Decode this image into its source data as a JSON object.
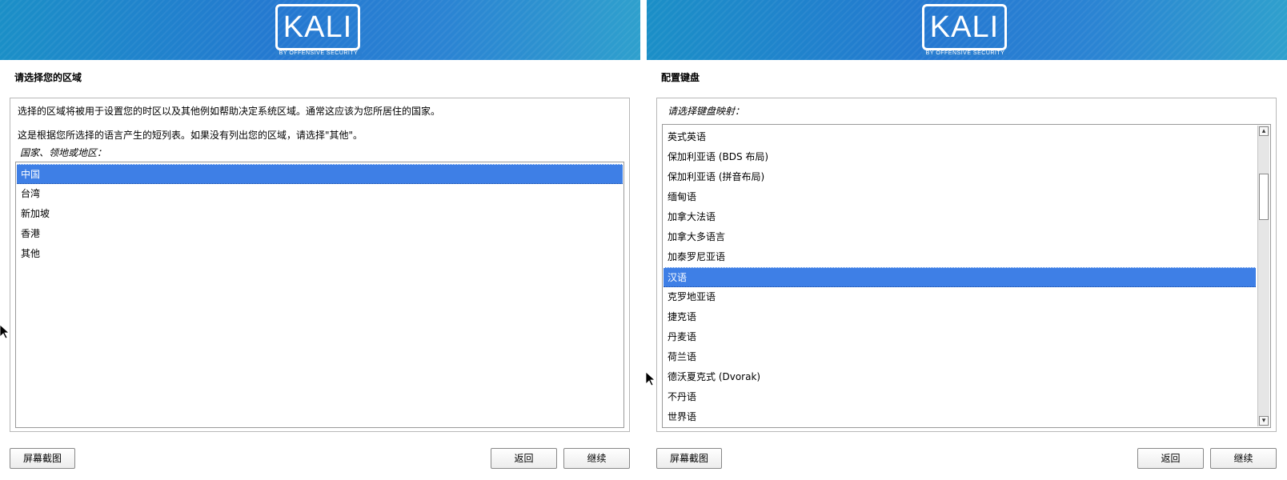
{
  "left": {
    "logo": {
      "text": "KALI",
      "subtitle": "BY OFFENSIVE SECURITY"
    },
    "title": "请选择您的区域",
    "description1": "选择的区域将被用于设置您的时区以及其他例如帮助决定系统区域。通常这应该为您所居住的国家。",
    "description2": "这是根据您所选择的语言产生的短列表。如果没有列出您的区域，请选择\"其他\"。",
    "prompt": "国家、领地或地区：",
    "items": [
      "中国",
      "台湾",
      "新加坡",
      "香港",
      "其他"
    ],
    "selected_index": 0,
    "buttons": {
      "screenshot": "屏幕截图",
      "back": "返回",
      "continue": "继续"
    }
  },
  "right": {
    "logo": {
      "text": "KALI",
      "subtitle": "BY OFFENSIVE SECURITY"
    },
    "title": "配置键盘",
    "prompt": "请选择键盘映射：",
    "items": [
      "英式英语",
      "保加利亚语 (BDS 布局)",
      "保加利亚语 (拼音布局)",
      "缅甸语",
      "加拿大法语",
      "加拿大多语言",
      "加泰罗尼亚语",
      "汉语",
      "克罗地亚语",
      "捷克语",
      "丹麦语",
      "荷兰语",
      "德沃夏克式 (Dvorak)",
      "不丹语",
      "世界语"
    ],
    "selected_index": 7,
    "buttons": {
      "screenshot": "屏幕截图",
      "back": "返回",
      "continue": "继续"
    }
  },
  "colors": {
    "banner_start": "#1b8fc7",
    "banner_end": "#2fa0cd",
    "selection": "#3e7fe6"
  }
}
